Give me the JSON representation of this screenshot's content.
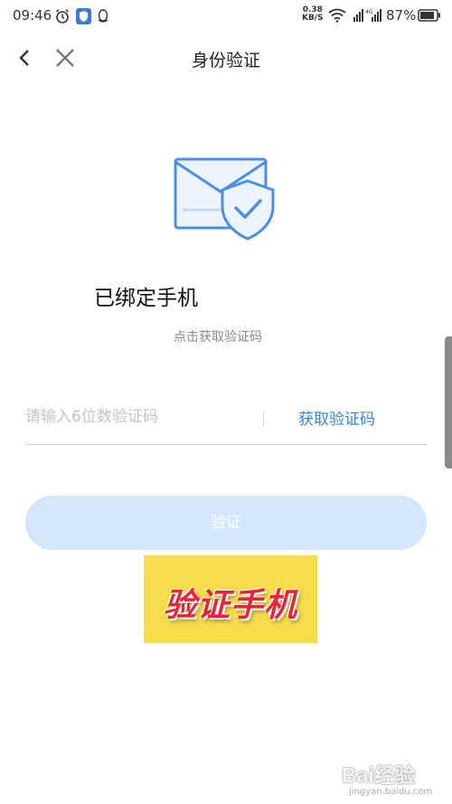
{
  "status_bar": {
    "time": "09:46",
    "net_speed_value": "0.38",
    "net_speed_unit": "KB/S",
    "battery": "87%"
  },
  "nav": {
    "title": "身份验证"
  },
  "main": {
    "bound_label": "已绑定手机",
    "hint": "点击获取验证码",
    "code_input": {
      "placeholder": "请输入6位数验证码",
      "value": ""
    },
    "get_code_label": "获取验证码",
    "verify_label": "验证"
  },
  "overlay": {
    "banner_text": "验证手机"
  },
  "watermark": {
    "brand": "Bai经验",
    "url": "jingyan.baidu.com"
  },
  "colors": {
    "accent": "#3a86d6",
    "verify_button_disabled": "#d3e6fb",
    "banner_bg": "#f7dd4b",
    "banner_text": "#e8233a"
  }
}
